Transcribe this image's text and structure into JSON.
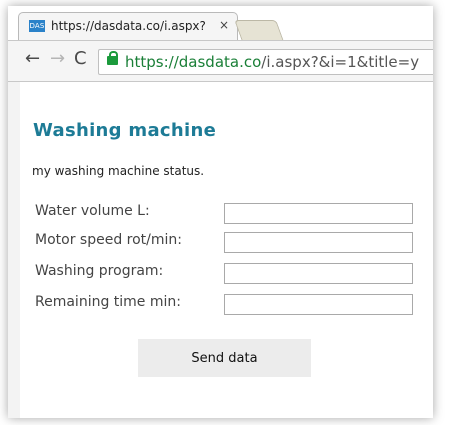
{
  "browser": {
    "tab_title": "https://dasdata.co/i.aspx?",
    "tab_favicon_text": "DAS",
    "tab_close": "×",
    "url_scheme": "https://",
    "url_host": "dasdata.co",
    "url_path": "/i.aspx?&i=1&title=y",
    "back_icon": "←",
    "forward_icon": "→",
    "reload_icon": "C"
  },
  "page": {
    "title": "Washing machine",
    "subtitle": "my washing machine status.",
    "fields": [
      {
        "label": "Water volume L:",
        "value": ""
      },
      {
        "label": "Motor speed rot/min:",
        "value": ""
      },
      {
        "label": "Washing program:",
        "value": ""
      },
      {
        "label": "Remaining time min:",
        "value": ""
      }
    ],
    "submit_label": "Send data"
  },
  "colors": {
    "title": "#1d7b96",
    "url_host": "#1a7f37",
    "lock": "#1b9a3c",
    "button_bg": "#ececec"
  }
}
